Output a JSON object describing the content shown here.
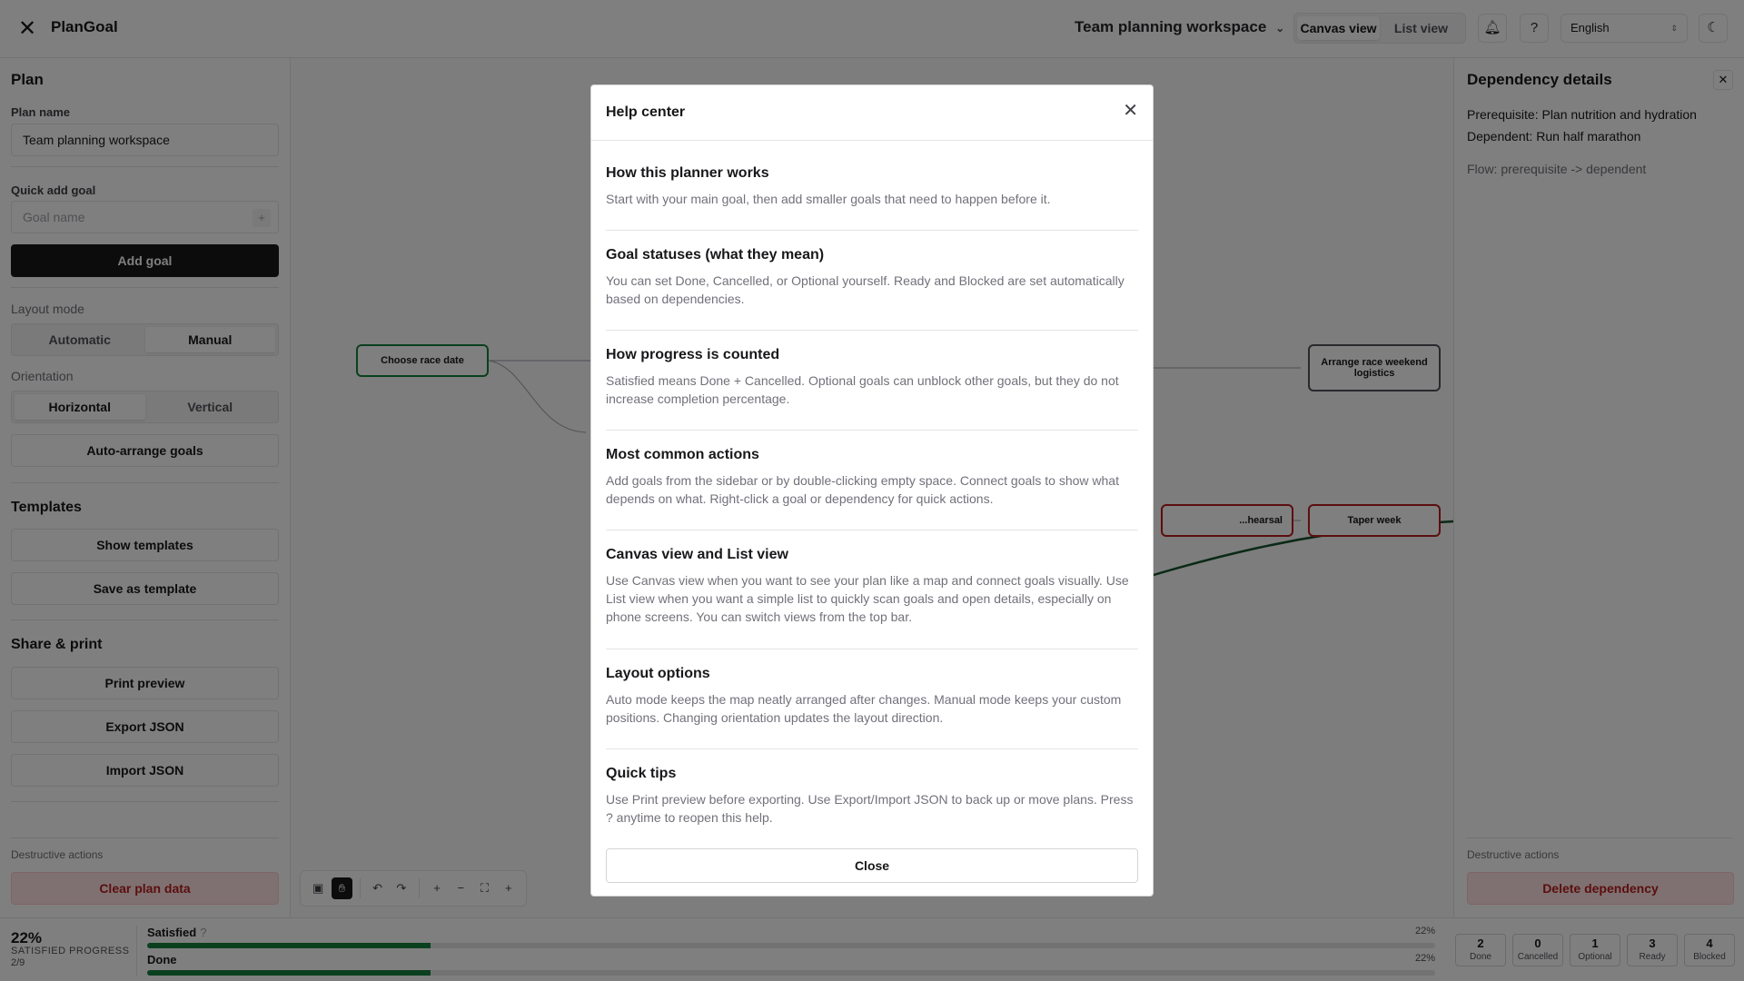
{
  "topbar": {
    "app_title": "PlanGoal",
    "workspace": "Team planning workspace",
    "view_canvas": "Canvas view",
    "view_list": "List view",
    "language": "English"
  },
  "sidebar": {
    "plan_heading": "Plan",
    "plan_name_label": "Plan name",
    "plan_name_value": "Team planning workspace",
    "quick_add_label": "Quick add goal",
    "goal_name_placeholder": "Goal name",
    "add_goal": "Add goal",
    "layout_mode_label": "Layout mode",
    "layout_automatic": "Automatic",
    "layout_manual": "Manual",
    "orientation_label": "Orientation",
    "orientation_horizontal": "Horizontal",
    "orientation_vertical": "Vertical",
    "auto_arrange": "Auto-arrange goals",
    "templates_heading": "Templates",
    "show_templates": "Show templates",
    "save_template": "Save as template",
    "share_heading": "Share & print",
    "print_preview": "Print preview",
    "export_json": "Export JSON",
    "import_json": "Import JSON",
    "destructive_label": "Destructive actions",
    "clear_plan": "Clear plan data"
  },
  "canvas": {
    "nodes": [
      {
        "label": "Choose race date",
        "status": "done"
      },
      {
        "label": "Arrange race weekend logistics",
        "status": "ready"
      },
      {
        "label": "...hearsal",
        "status": "blocked"
      },
      {
        "label": "Taper week",
        "status": "blocked"
      }
    ]
  },
  "right_panel": {
    "title": "Dependency details",
    "prerequisite": "Prerequisite: Plan nutrition and hydration",
    "dependent": "Dependent: Run half marathon",
    "flow": "Flow: prerequisite -> dependent",
    "destructive_label": "Destructive actions",
    "delete_dependency": "Delete dependency"
  },
  "bottombar": {
    "percent": "22%",
    "progress_label": "SATISFIED PROGRESS",
    "fraction": "2/9",
    "bars": [
      {
        "name": "Satisfied",
        "help": "?",
        "value_text": "22%",
        "fraction": 0.22
      },
      {
        "name": "Done",
        "help": "",
        "value_text": "22%",
        "fraction": 0.22
      }
    ],
    "stats": [
      {
        "count": "2",
        "label": "Done"
      },
      {
        "count": "0",
        "label": "Cancelled"
      },
      {
        "count": "1",
        "label": "Optional"
      },
      {
        "count": "3",
        "label": "Ready"
      },
      {
        "count": "4",
        "label": "Blocked"
      }
    ]
  },
  "modal": {
    "title": "Help center",
    "sections": [
      {
        "heading": "How this planner works",
        "body": "Start with your main goal, then add smaller goals that need to happen before it."
      },
      {
        "heading": "Goal statuses (what they mean)",
        "body": "You can set Done, Cancelled, or Optional yourself. Ready and Blocked are set automatically based on dependencies."
      },
      {
        "heading": "How progress is counted",
        "body": "Satisfied means Done + Cancelled. Optional goals can unblock other goals, but they do not increase completion percentage."
      },
      {
        "heading": "Most common actions",
        "body": "Add goals from the sidebar or by double-clicking empty space. Connect goals to show what depends on what. Right-click a goal or dependency for quick actions."
      },
      {
        "heading": "Canvas view and List view",
        "body": "Use Canvas view when you want to see your plan like a map and connect goals visually. Use List view when you want a simple list to quickly scan goals and open details, especially on phone screens. You can switch views from the top bar."
      },
      {
        "heading": "Layout options",
        "body": "Auto mode keeps the map neatly arranged after changes. Manual mode keeps your custom positions. Changing orientation updates the layout direction."
      },
      {
        "heading": "Quick tips",
        "body": "Use Print preview before exporting. Use Export/Import JSON to back up or move plans. Press ? anytime to reopen this help."
      }
    ],
    "close_button": "Close"
  },
  "colors": {
    "done_border": "#15803d",
    "blocked_border": "#b91c1c",
    "progress_fill": "#15803d"
  }
}
